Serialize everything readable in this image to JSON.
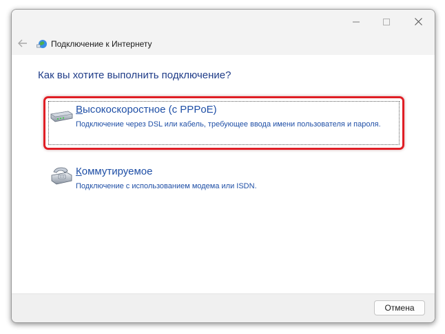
{
  "window": {
    "title": "Подключение к Интернету"
  },
  "caption": {
    "minimize_icon": "minimize-icon",
    "maximize_icon": "maximize-icon",
    "close_icon": "close-icon"
  },
  "nav": {
    "back_icon": "back-arrow-icon"
  },
  "content": {
    "question": "Как вы хотите выполнить подключение?",
    "options": [
      {
        "accel": "В",
        "title_rest": "ысокоскоростное (с PPPoE)",
        "description": "Подключение через DSL или кабель, требующее ввода имени пользователя и пароля.",
        "icon": "modem-icon",
        "highlighted": true
      },
      {
        "accel": "К",
        "title_rest": "оммутируемое",
        "description": "Подключение с использованием модема или ISDN.",
        "icon": "telephone-modem-icon",
        "highlighted": false
      }
    ]
  },
  "footer": {
    "cancel_label": "Отмена"
  },
  "colors": {
    "link_blue": "#1f4fa6",
    "heading_blue": "#1f3c88",
    "highlight_red": "#e01e25"
  }
}
